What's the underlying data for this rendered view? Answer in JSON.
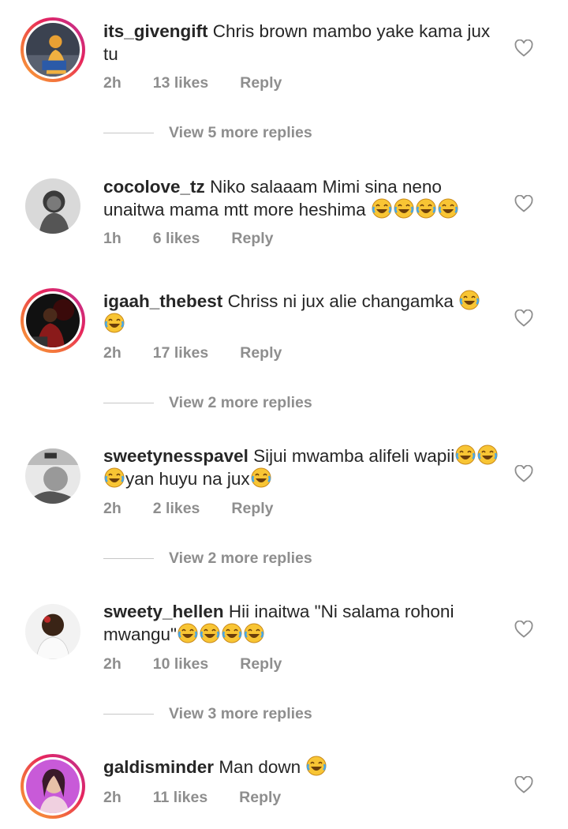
{
  "comments": [
    {
      "username": "its_givengift",
      "text": "Chris brown mambo yake kama jux tu",
      "time": "2h",
      "likes": "13 likes",
      "reply": "Reply",
      "view_replies": "View 5 more replies"
    },
    {
      "username": "cocolove_tz",
      "text": "Niko salaaam Mimi sina neno unaitwa mama mtt more heshima 😂😂😂😂",
      "time": "1h",
      "likes": "6 likes",
      "reply": "Reply"
    },
    {
      "username": "igaah_thebest",
      "text": "Chriss ni jux alie changamka 😂😂",
      "time": "2h",
      "likes": "17 likes",
      "reply": "Reply",
      "view_replies": "View 2 more replies"
    },
    {
      "username": "sweetynesspavel",
      "text": "Sijui mwamba alifeli wapii😂😂😂yan huyu na jux😂",
      "time": "2h",
      "likes": "2 likes",
      "reply": "Reply",
      "view_replies": "View 2 more replies"
    },
    {
      "username": "sweety_hellen",
      "text": "Hii inaitwa \"Ni salama rohoni mwangu\"😂😂😂😂",
      "time": "2h",
      "likes": "10 likes",
      "reply": "Reply",
      "view_replies": "View 3 more replies"
    },
    {
      "username": "galdisminder",
      "text": "Man down 😂",
      "time": "2h",
      "likes": "11 likes",
      "reply": "Reply"
    }
  ],
  "icons": {
    "like": "heart-outline-icon",
    "emoji": "face-with-tears-of-joy"
  },
  "colors": {
    "text": "#262626",
    "secondary": "#8e8e8e",
    "story_ring": "#e6245e"
  }
}
